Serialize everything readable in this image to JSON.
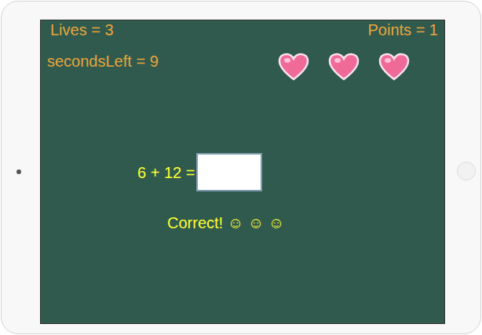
{
  "hud": {
    "lives": "Lives = 3",
    "points": "Points = 1",
    "seconds_left": "secondsLeft = 9"
  },
  "hearts": [
    {
      "filled": true
    },
    {
      "filled": true
    },
    {
      "filled": true
    }
  ],
  "question": {
    "text": "6 + 12 =",
    "answer": {
      "value": ""
    }
  },
  "feedback": "Correct! ☺ ☺ ☺"
}
